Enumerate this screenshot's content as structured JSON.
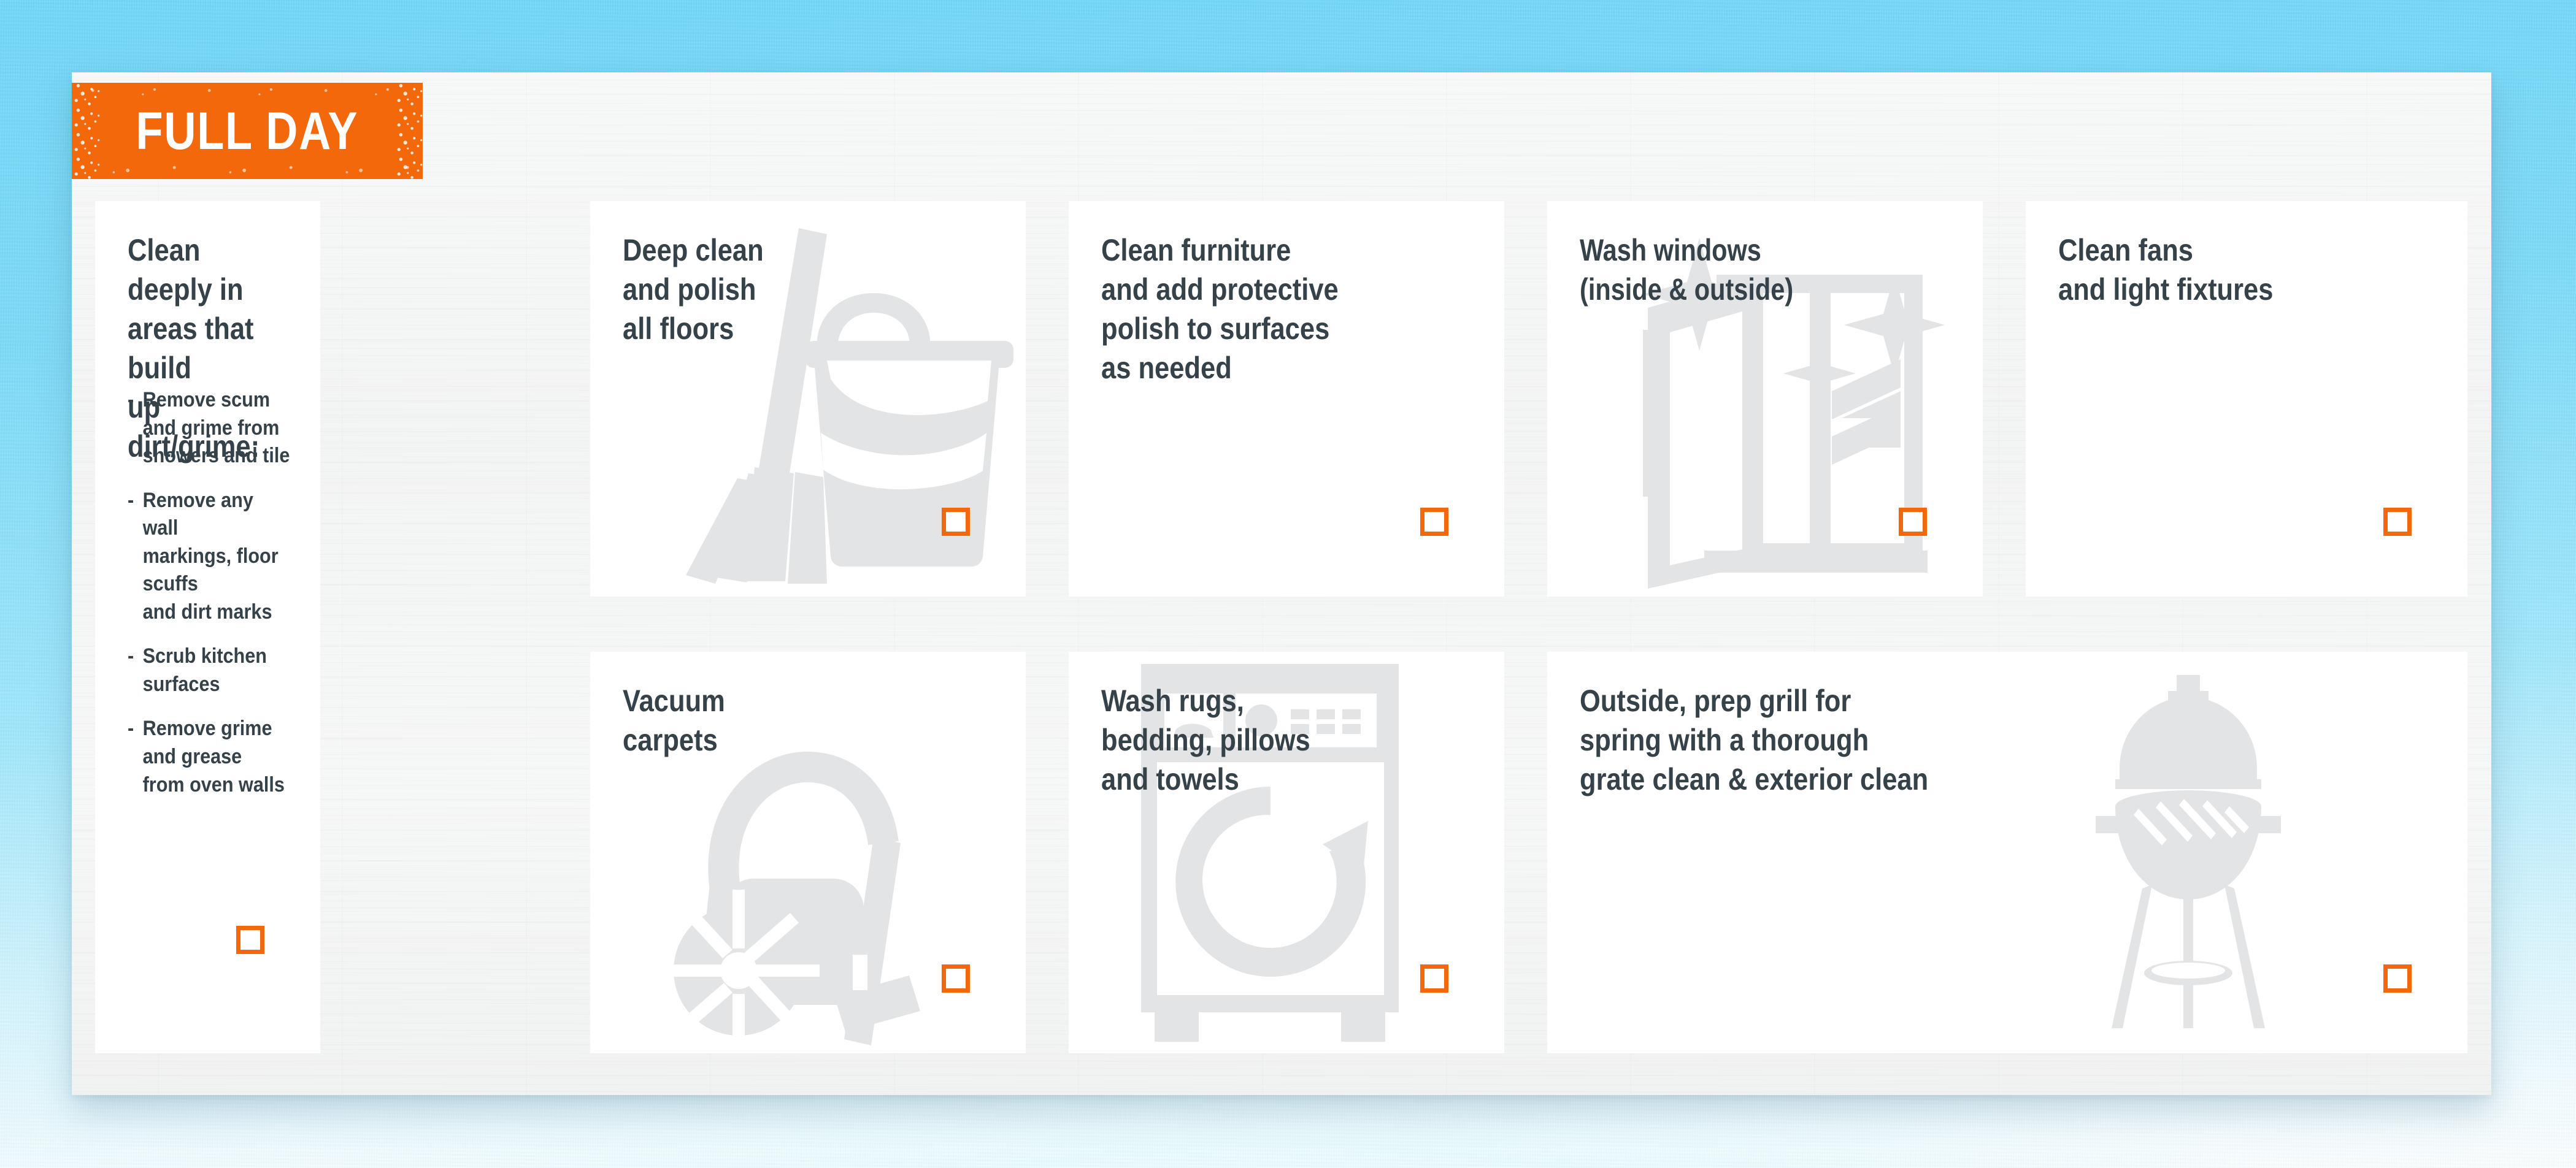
{
  "theme": {
    "accent_orange": "#f4680c",
    "text_dark": "#35424a",
    "illustration_gray": "#e3e4e5",
    "panel_white": "#f4f5f5",
    "sky_blue": "#7bdaf8",
    "card_white": "#ffffff"
  },
  "banner": {
    "label": "FULL DAY"
  },
  "cards": [
    {
      "id": "deep-clean-areas",
      "title": "Clean deeply in\nareas that build\nup dirt/grime:",
      "bullet_marker": "-",
      "bullets": [
        "Remove scum\nand grime from\nshowers and tile",
        "Remove any wall\nmarkings, floor scuffs\nand dirt marks",
        "Scrub kitchen surfaces",
        "Remove grime and grease\nfrom oven walls"
      ],
      "icon": "none",
      "checkbox_checked": false
    },
    {
      "id": "deep-clean-floors",
      "title": "Deep clean\nand polish\nall floors",
      "icon": "broom-bucket-icon",
      "checkbox_checked": false
    },
    {
      "id": "clean-furniture",
      "title": "Clean furniture\nand add protective\npolish to surfaces\nas needed",
      "icon": "none",
      "checkbox_checked": false
    },
    {
      "id": "wash-windows",
      "title": "Wash windows\n(inside & outside)",
      "icon": "window-sparkle-icon",
      "checkbox_checked": false
    },
    {
      "id": "clean-fans",
      "title": "Clean fans\nand light fixtures",
      "icon": "none",
      "checkbox_checked": false
    },
    {
      "id": "vacuum-carpets",
      "title": "Vacuum\ncarpets",
      "icon": "vacuum-cleaner-icon",
      "checkbox_checked": false
    },
    {
      "id": "wash-rugs",
      "title": "Wash rugs,\nbedding, pillows\nand towels",
      "icon": "washing-machine-icon",
      "checkbox_checked": false
    },
    {
      "id": "prep-grill",
      "title": "Outside, prep grill for\nspring with a thorough\ngrate clean & exterior clean",
      "icon": "bbq-grill-icon",
      "checkbox_checked": false
    }
  ]
}
